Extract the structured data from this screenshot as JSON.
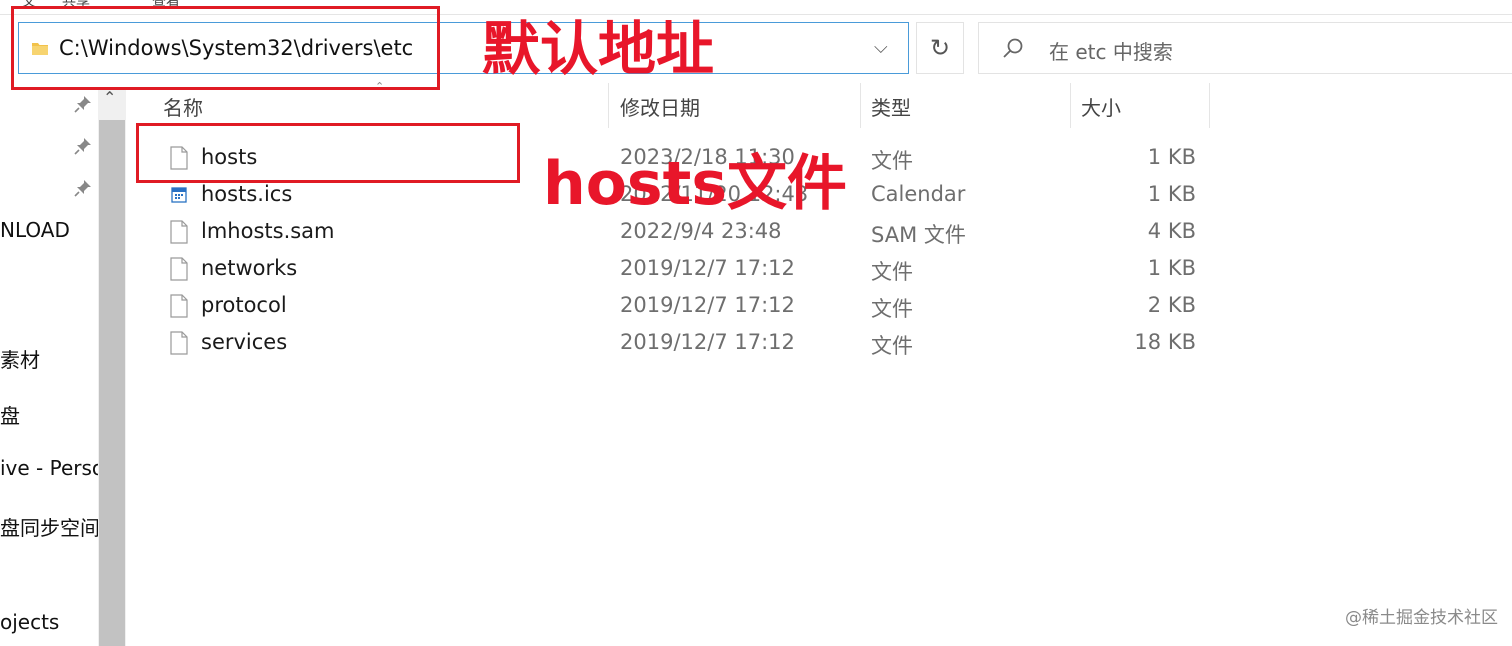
{
  "ribbon": {
    "fragments": [
      "文",
      "共享",
      "查看"
    ]
  },
  "address_bar": {
    "path": "C:\\Windows\\System32\\drivers\\etc"
  },
  "search": {
    "placeholder": "在 etc 中搜索"
  },
  "nav": {
    "items": [
      "NLOAD",
      "素材",
      "盘",
      "ive - Perso",
      "盘同步空间",
      "ojects"
    ]
  },
  "columns": {
    "name": "名称",
    "date": "修改日期",
    "type": "类型",
    "size": "大小"
  },
  "files": [
    {
      "name": "hosts",
      "date": "2023/2/18 11:30",
      "type": "文件",
      "size": "1 KB",
      "icon": "blank-file-icon"
    },
    {
      "name": "hosts.ics",
      "date": "2022/11/20 12:43",
      "type": "Calendar",
      "size": "1 KB",
      "icon": "calendar-file-icon"
    },
    {
      "name": "lmhosts.sam",
      "date": "2022/9/4 23:48",
      "type": "SAM 文件",
      "size": "4 KB",
      "icon": "blank-file-icon"
    },
    {
      "name": "networks",
      "date": "2019/12/7 17:12",
      "type": "文件",
      "size": "1 KB",
      "icon": "blank-file-icon"
    },
    {
      "name": "protocol",
      "date": "2019/12/7 17:12",
      "type": "文件",
      "size": "2 KB",
      "icon": "blank-file-icon"
    },
    {
      "name": "services",
      "date": "2019/12/7 17:12",
      "type": "文件",
      "size": "18 KB",
      "icon": "blank-file-icon"
    }
  ],
  "annotations": {
    "default_address": "默认地址",
    "hosts_file": "hosts文件",
    "color": "#e01b24"
  },
  "watermark": "@稀土掘金技术社区",
  "colors": {
    "address_border": "#4a9bd9",
    "folder": "#f2c24b"
  }
}
